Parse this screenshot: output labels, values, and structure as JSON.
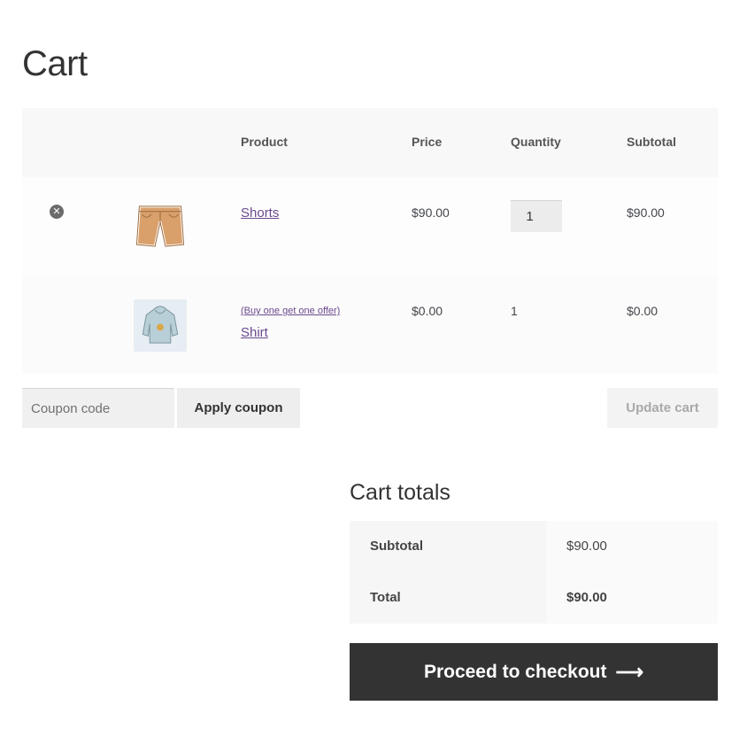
{
  "page": {
    "title": "Cart"
  },
  "table": {
    "headers": {
      "product": "Product",
      "price": "Price",
      "quantity": "Quantity",
      "subtotal": "Subtotal"
    },
    "items": [
      {
        "name": "Shorts",
        "price": "$90.00",
        "quantity": "1",
        "subtotal": "$90.00",
        "icon": "shorts-thumbnail"
      },
      {
        "offer": "(Buy one get one offer)",
        "name": "Shirt",
        "price": "$0.00",
        "quantity": "1",
        "subtotal": "$0.00",
        "icon": "hoodie-thumbnail"
      }
    ],
    "remove_icon": "close-circle-icon"
  },
  "coupon": {
    "placeholder": "Coupon code",
    "apply_label": "Apply coupon"
  },
  "update_label": "Update cart",
  "totals": {
    "title": "Cart totals",
    "subtotal_label": "Subtotal",
    "subtotal_value": "$90.00",
    "total_label": "Total",
    "total_value": "$90.00"
  },
  "checkout": {
    "label": "Proceed to checkout",
    "icon": "arrow-right-icon"
  },
  "colors": {
    "link": "#6b4a8f",
    "checkout_bg": "#333333"
  }
}
